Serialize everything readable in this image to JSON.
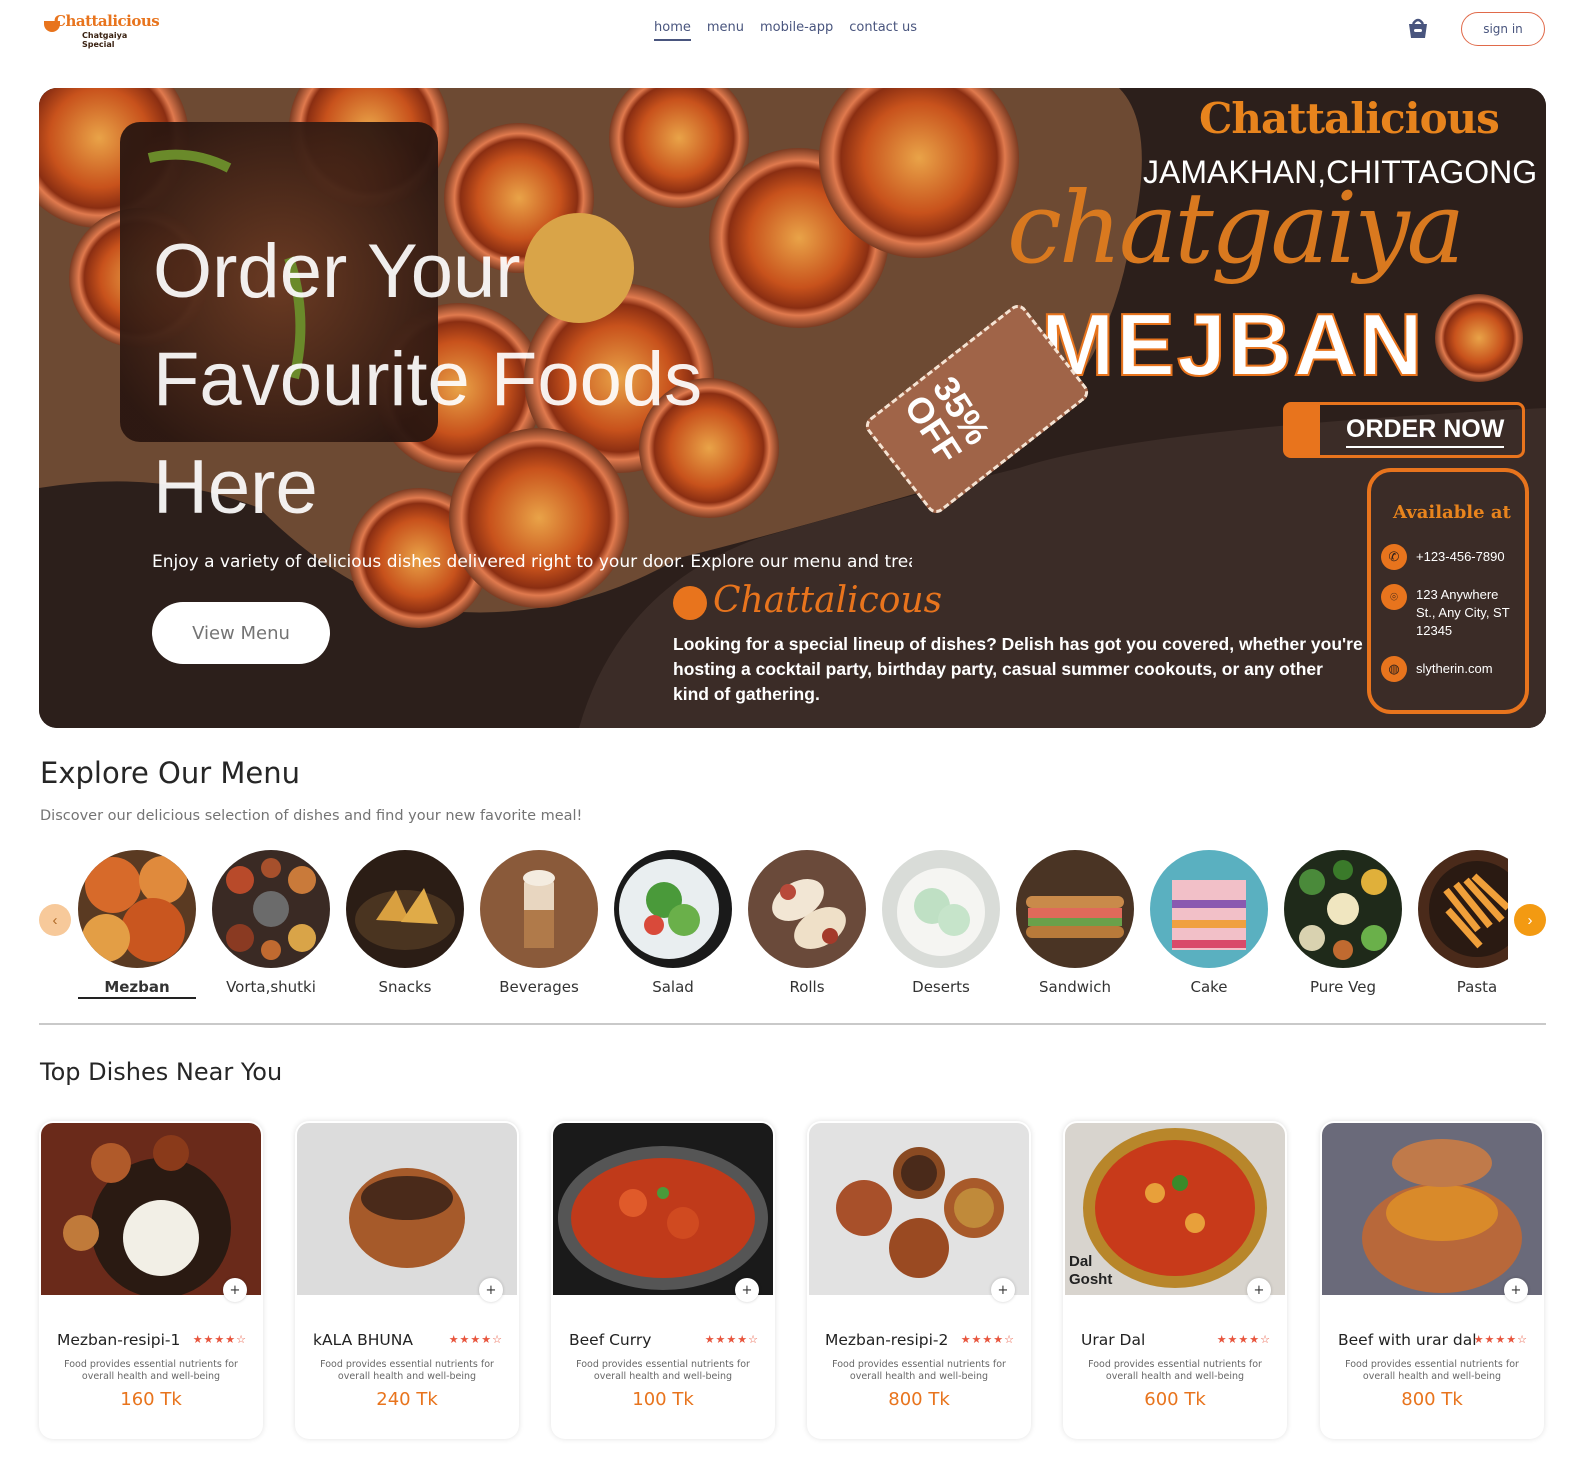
{
  "logo": {
    "name": "Chattalicious",
    "tagline": "Chatgaiya Special"
  },
  "nav": {
    "items": [
      "home",
      "menu",
      "mobile-app",
      "contact us"
    ],
    "active": "home",
    "sign_in": "sign in"
  },
  "hero": {
    "title": "Order Your Favourite Foods Here",
    "text": "Enjoy a variety of delicious dishes delivered right to your door. Explore our menu and treat y",
    "button": "View Menu",
    "banner": {
      "brand": "Chattalicious",
      "city": "JAMAKHAN,CHITTAGONG",
      "script": "chatgaiya",
      "headline": "MEJBAN",
      "discount": "35% OFF",
      "cta": "ORDER NOW",
      "available_title": "Available at",
      "phone": "+123-456-7890",
      "address": "123 Anywhere St., Any City, ST 12345",
      "website": "slytherin.com",
      "brand_script": "Chattalicous",
      "description": "Looking for a special lineup of dishes? Delish has got you covered, whether you're hosting a cocktail party, birthday party, casual summer cookouts, or any other kind of gathering."
    }
  },
  "explore": {
    "title": "Explore Our Menu",
    "subtitle": "Discover our delicious selection of dishes and find your new favorite meal!",
    "categories": [
      {
        "label": "Mezban",
        "active": true
      },
      {
        "label": "Vorta,shutki"
      },
      {
        "label": "Snacks"
      },
      {
        "label": "Beverages"
      },
      {
        "label": "Salad"
      },
      {
        "label": "Rolls"
      },
      {
        "label": "Deserts"
      },
      {
        "label": "Sandwich"
      },
      {
        "label": "Cake"
      },
      {
        "label": "Pure Veg"
      },
      {
        "label": "Pasta"
      }
    ]
  },
  "top_dishes": {
    "title": "Top Dishes Near You",
    "items": [
      {
        "name": "Mezban-resipi-1",
        "rating": 4,
        "desc": "Food provides essential nutrients for overall health and well-being",
        "price": "160 Tk"
      },
      {
        "name": "kALA BHUNA",
        "rating": 4,
        "desc": "Food provides essential nutrients for overall health and well-being",
        "price": "240 Tk"
      },
      {
        "name": "Beef Curry",
        "rating": 4,
        "desc": "Food provides essential nutrients for overall health and well-being",
        "price": "100 Tk"
      },
      {
        "name": "Mezban-resipi-2",
        "rating": 4,
        "desc": "Food provides essential nutrients for overall health and well-being",
        "price": "800 Tk"
      },
      {
        "name": "Urar Dal",
        "rating": 4,
        "desc": "Food provides essential nutrients for overall health and well-being",
        "price": "600 Tk",
        "image_caption": "Dal Gosht"
      },
      {
        "name": "Beef with urar dal",
        "rating": 4,
        "desc": "Food provides essential nutrients for overall health and well-being",
        "price": "800 Tk"
      }
    ]
  },
  "colors": {
    "accent": "#e8741d",
    "nav_text": "#49557e",
    "hero_bg": "#2c1f1b",
    "price": "#e8741d"
  }
}
